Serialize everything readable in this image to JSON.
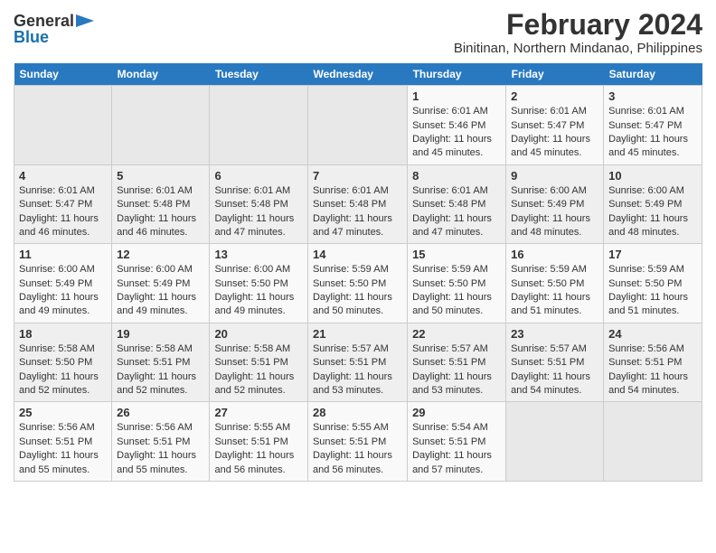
{
  "header": {
    "logo_general": "General",
    "logo_blue": "Blue",
    "month_year": "February 2024",
    "location": "Binitinan, Northern Mindanao, Philippines"
  },
  "calendar": {
    "days_of_week": [
      "Sunday",
      "Monday",
      "Tuesday",
      "Wednesday",
      "Thursday",
      "Friday",
      "Saturday"
    ],
    "weeks": [
      [
        {
          "day": "",
          "info": ""
        },
        {
          "day": "",
          "info": ""
        },
        {
          "day": "",
          "info": ""
        },
        {
          "day": "",
          "info": ""
        },
        {
          "day": "1",
          "info": "Sunrise: 6:01 AM\nSunset: 5:46 PM\nDaylight: 11 hours and 45 minutes."
        },
        {
          "day": "2",
          "info": "Sunrise: 6:01 AM\nSunset: 5:47 PM\nDaylight: 11 hours and 45 minutes."
        },
        {
          "day": "3",
          "info": "Sunrise: 6:01 AM\nSunset: 5:47 PM\nDaylight: 11 hours and 45 minutes."
        }
      ],
      [
        {
          "day": "4",
          "info": "Sunrise: 6:01 AM\nSunset: 5:47 PM\nDaylight: 11 hours and 46 minutes."
        },
        {
          "day": "5",
          "info": "Sunrise: 6:01 AM\nSunset: 5:48 PM\nDaylight: 11 hours and 46 minutes."
        },
        {
          "day": "6",
          "info": "Sunrise: 6:01 AM\nSunset: 5:48 PM\nDaylight: 11 hours and 47 minutes."
        },
        {
          "day": "7",
          "info": "Sunrise: 6:01 AM\nSunset: 5:48 PM\nDaylight: 11 hours and 47 minutes."
        },
        {
          "day": "8",
          "info": "Sunrise: 6:01 AM\nSunset: 5:48 PM\nDaylight: 11 hours and 47 minutes."
        },
        {
          "day": "9",
          "info": "Sunrise: 6:00 AM\nSunset: 5:49 PM\nDaylight: 11 hours and 48 minutes."
        },
        {
          "day": "10",
          "info": "Sunrise: 6:00 AM\nSunset: 5:49 PM\nDaylight: 11 hours and 48 minutes."
        }
      ],
      [
        {
          "day": "11",
          "info": "Sunrise: 6:00 AM\nSunset: 5:49 PM\nDaylight: 11 hours and 49 minutes."
        },
        {
          "day": "12",
          "info": "Sunrise: 6:00 AM\nSunset: 5:49 PM\nDaylight: 11 hours and 49 minutes."
        },
        {
          "day": "13",
          "info": "Sunrise: 6:00 AM\nSunset: 5:50 PM\nDaylight: 11 hours and 49 minutes."
        },
        {
          "day": "14",
          "info": "Sunrise: 5:59 AM\nSunset: 5:50 PM\nDaylight: 11 hours and 50 minutes."
        },
        {
          "day": "15",
          "info": "Sunrise: 5:59 AM\nSunset: 5:50 PM\nDaylight: 11 hours and 50 minutes."
        },
        {
          "day": "16",
          "info": "Sunrise: 5:59 AM\nSunset: 5:50 PM\nDaylight: 11 hours and 51 minutes."
        },
        {
          "day": "17",
          "info": "Sunrise: 5:59 AM\nSunset: 5:50 PM\nDaylight: 11 hours and 51 minutes."
        }
      ],
      [
        {
          "day": "18",
          "info": "Sunrise: 5:58 AM\nSunset: 5:50 PM\nDaylight: 11 hours and 52 minutes."
        },
        {
          "day": "19",
          "info": "Sunrise: 5:58 AM\nSunset: 5:51 PM\nDaylight: 11 hours and 52 minutes."
        },
        {
          "day": "20",
          "info": "Sunrise: 5:58 AM\nSunset: 5:51 PM\nDaylight: 11 hours and 52 minutes."
        },
        {
          "day": "21",
          "info": "Sunrise: 5:57 AM\nSunset: 5:51 PM\nDaylight: 11 hours and 53 minutes."
        },
        {
          "day": "22",
          "info": "Sunrise: 5:57 AM\nSunset: 5:51 PM\nDaylight: 11 hours and 53 minutes."
        },
        {
          "day": "23",
          "info": "Sunrise: 5:57 AM\nSunset: 5:51 PM\nDaylight: 11 hours and 54 minutes."
        },
        {
          "day": "24",
          "info": "Sunrise: 5:56 AM\nSunset: 5:51 PM\nDaylight: 11 hours and 54 minutes."
        }
      ],
      [
        {
          "day": "25",
          "info": "Sunrise: 5:56 AM\nSunset: 5:51 PM\nDaylight: 11 hours and 55 minutes."
        },
        {
          "day": "26",
          "info": "Sunrise: 5:56 AM\nSunset: 5:51 PM\nDaylight: 11 hours and 55 minutes."
        },
        {
          "day": "27",
          "info": "Sunrise: 5:55 AM\nSunset: 5:51 PM\nDaylight: 11 hours and 56 minutes."
        },
        {
          "day": "28",
          "info": "Sunrise: 5:55 AM\nSunset: 5:51 PM\nDaylight: 11 hours and 56 minutes."
        },
        {
          "day": "29",
          "info": "Sunrise: 5:54 AM\nSunset: 5:51 PM\nDaylight: 11 hours and 57 minutes."
        },
        {
          "day": "",
          "info": ""
        },
        {
          "day": "",
          "info": ""
        }
      ]
    ]
  }
}
